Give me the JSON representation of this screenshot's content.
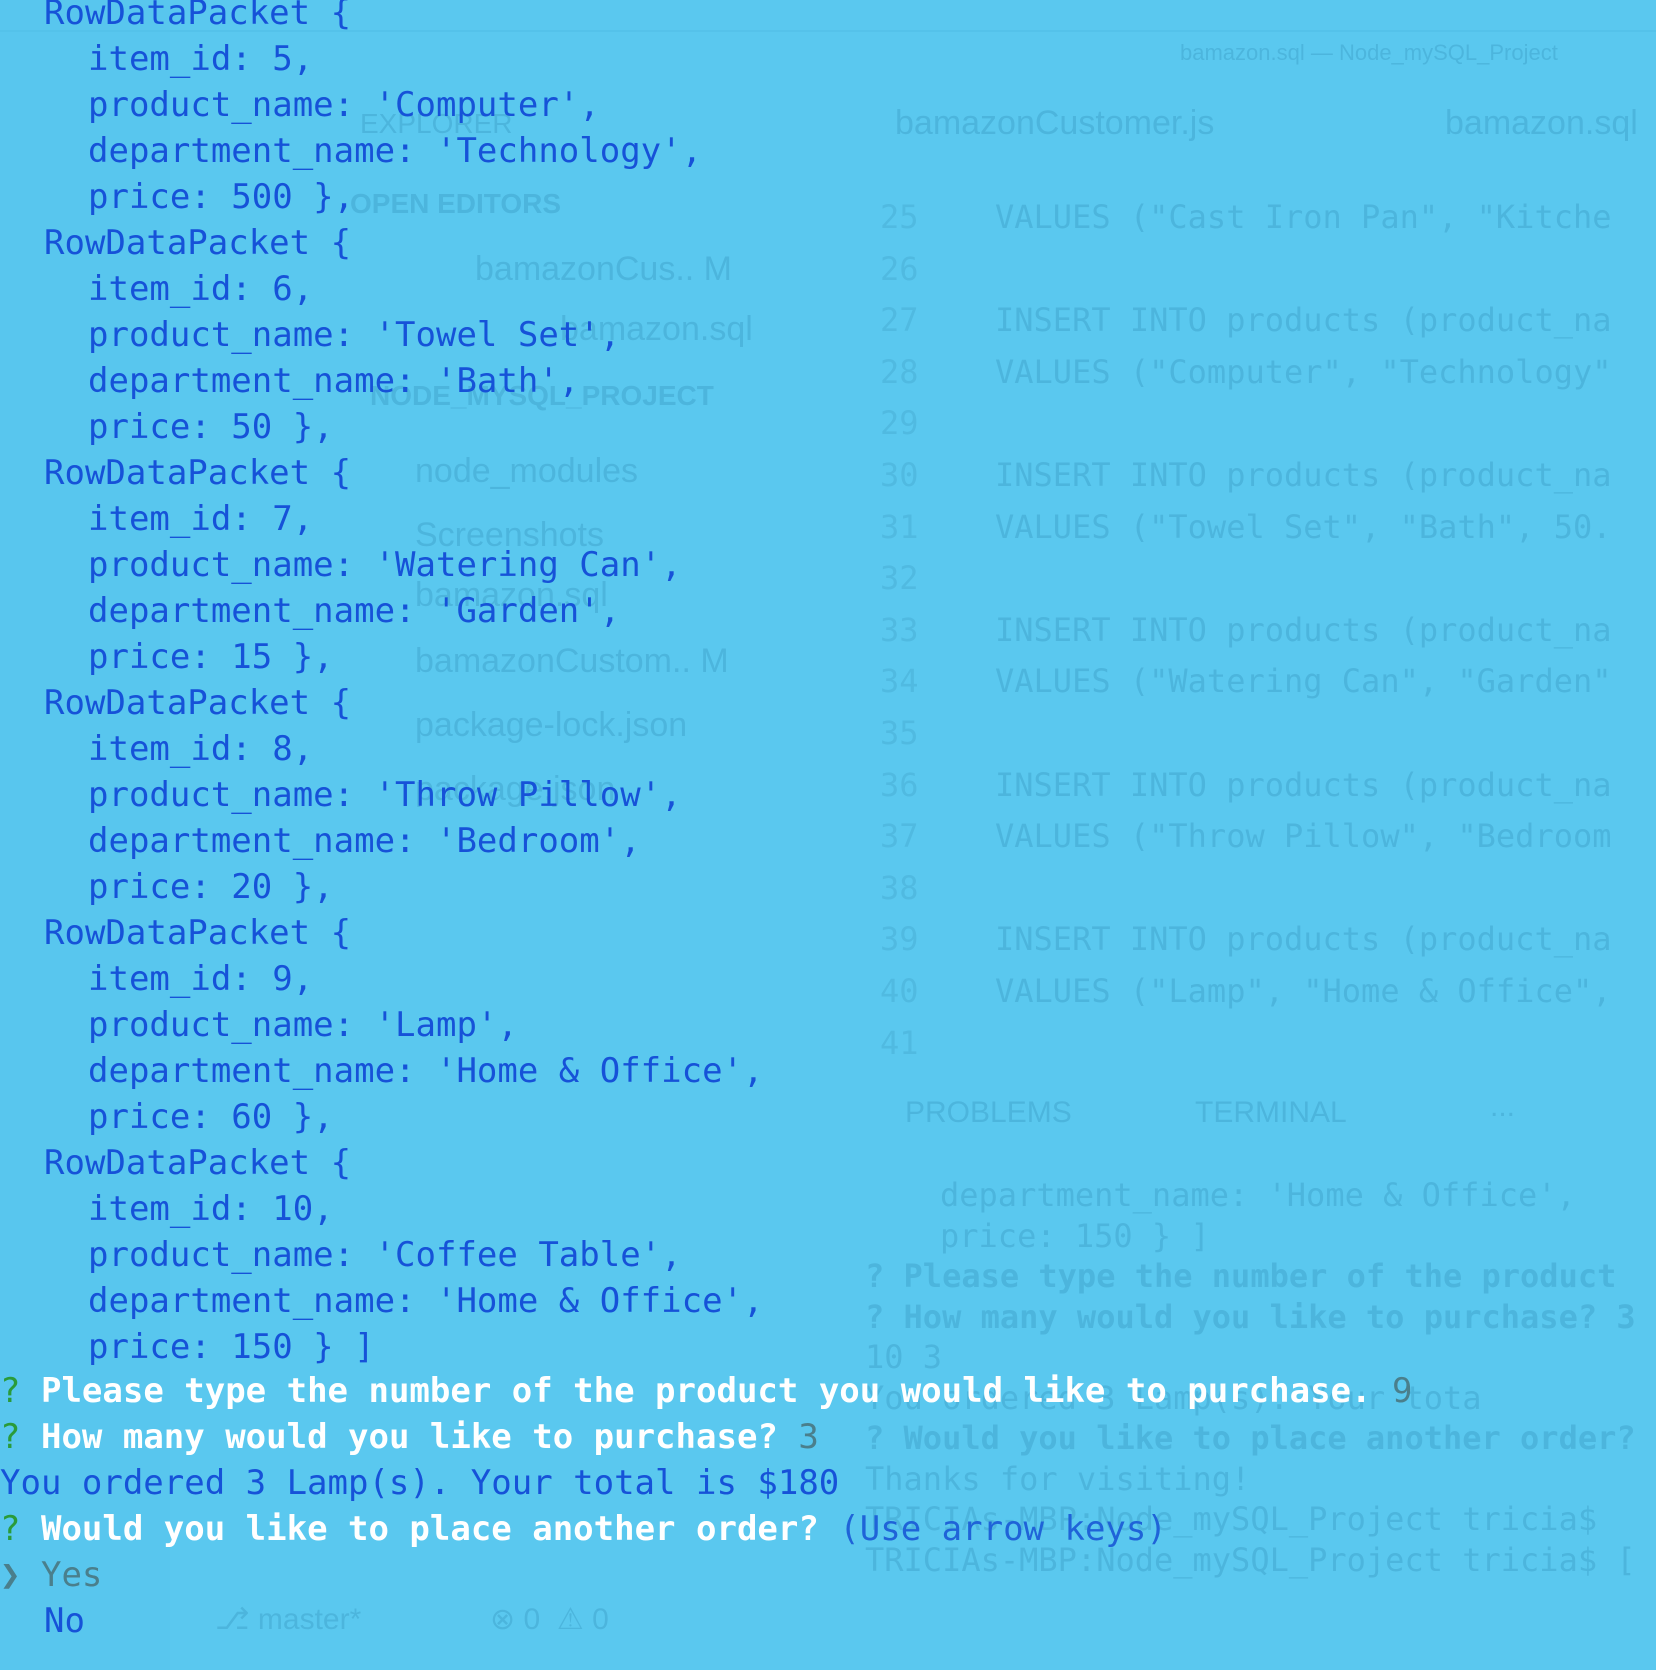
{
  "ghost": {
    "window_title": "bamazon.sql — Node_mySQL_Project",
    "tabs": [
      "bamazonCustomer.js",
      "bamazon.sql"
    ],
    "explorer_label": "EXPLORER",
    "open_editors_label": "OPEN EDITORS",
    "open_editors": [
      "bamazonCus.. M",
      "bamazon.sql"
    ],
    "project_label": "NODE_MYSQL_PROJECT",
    "files": [
      "node_modules",
      "Screenshots",
      "bamazon.sql",
      "bamazonCustom.. M",
      "package-lock.json",
      "package.json"
    ],
    "code_lines": [
      {
        "num": "25",
        "text": "VALUES (\"Cast Iron Pan\", \"Kitche"
      },
      {
        "num": "26",
        "text": ""
      },
      {
        "num": "27",
        "text": "INSERT INTO products (product_na"
      },
      {
        "num": "28",
        "text": "VALUES (\"Computer\", \"Technology\""
      },
      {
        "num": "29",
        "text": ""
      },
      {
        "num": "30",
        "text": "INSERT INTO products (product_na"
      },
      {
        "num": "31",
        "text": "VALUES (\"Towel Set\", \"Bath\", 50."
      },
      {
        "num": "32",
        "text": ""
      },
      {
        "num": "33",
        "text": "INSERT INTO products (product_na"
      },
      {
        "num": "34",
        "text": "VALUES (\"Watering Can\", \"Garden\""
      },
      {
        "num": "35",
        "text": ""
      },
      {
        "num": "36",
        "text": "INSERT INTO products (product_na"
      },
      {
        "num": "37",
        "text": "VALUES (\"Throw Pillow\", \"Bedroom"
      },
      {
        "num": "38",
        "text": ""
      },
      {
        "num": "39",
        "text": "INSERT INTO products (product_na"
      },
      {
        "num": "40",
        "text": "VALUES (\"Lamp\", \"Home & Office\","
      },
      {
        "num": "41",
        "text": ""
      }
    ],
    "panel_tabs": [
      "PROBLEMS",
      "TERMINAL",
      "..."
    ],
    "panel_lines": [
      "department_name: 'Home & Office',",
      "price: 150 } ]",
      "? Please type the number of the product",
      "? How many would you like to purchase? 3",
      "10 3",
      "You ordered 3 Lamp(s). Your tota",
      "? Would you like to place another order?",
      "Thanks for visiting!",
      "TRICIAs-MBP:Node_mySQL_Project tricia$",
      "TRICIAs-MBP:Node_mySQL_Project tricia$ ["
    ],
    "status": {
      "branch": "master*",
      "errors": "0",
      "warnings": "0"
    }
  },
  "terminal": {
    "header": "RowDataPacket {",
    "rows": [
      {
        "open": "RowDataPacket {",
        "item_id": "item_id: 5,",
        "product_name": "product_name: 'Computer',",
        "department_name": "department_name: 'Technology',",
        "price": "price: 500 },"
      },
      {
        "open": "RowDataPacket {",
        "item_id": "item_id: 6,",
        "product_name": "product_name: 'Towel Set',",
        "department_name": "department_name: 'Bath',",
        "price": "price: 50 },"
      },
      {
        "open": "RowDataPacket {",
        "item_id": "item_id: 7,",
        "product_name": "product_name: 'Watering Can',",
        "department_name": "department_name: 'Garden',",
        "price": "price: 15 },"
      },
      {
        "open": "RowDataPacket {",
        "item_id": "item_id: 8,",
        "product_name": "product_name: 'Throw Pillow',",
        "department_name": "department_name: 'Bedroom',",
        "price": "price: 20 },"
      },
      {
        "open": "RowDataPacket {",
        "item_id": "item_id: 9,",
        "product_name": "product_name: 'Lamp',",
        "department_name": "department_name: 'Home & Office',",
        "price": "price: 60 },"
      },
      {
        "open": "RowDataPacket {",
        "item_id": "item_id: 10,",
        "product_name": "product_name: 'Coffee Table',",
        "department_name": "department_name: 'Home & Office',",
        "price": "price: 150 } ]"
      }
    ],
    "prompt_mark": "?",
    "q1": "Please type the number of the product you would like to purchase.",
    "q1_answer": "9",
    "q2": "How many would you like to purchase?",
    "q2_answer": "3",
    "result": "You ordered 3 Lamp(s). Your total is $180",
    "q3": "Would you like to place another order?",
    "q3_hint": "(Use arrow keys)",
    "pointer": "❯",
    "options": [
      "Yes",
      "No"
    ]
  }
}
